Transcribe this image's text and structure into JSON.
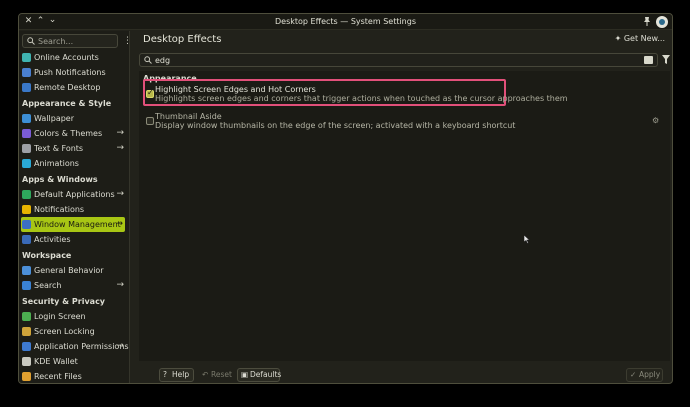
{
  "window": {
    "title": "Desktop Effects — System Settings"
  },
  "sidebar": {
    "search_placeholder": "Search...",
    "items_top": [
      {
        "label": "Online Accounts",
        "icon": "online-accounts-icon",
        "color": "#3fb3b0"
      },
      {
        "label": "Push Notifications",
        "icon": "push-notifications-icon",
        "color": "#4a7fd0"
      },
      {
        "label": "Remote Desktop",
        "icon": "remote-desktop-icon",
        "color": "#3a78c8"
      }
    ],
    "sections": [
      {
        "title": "Appearance & Style",
        "items": [
          {
            "label": "Wallpaper",
            "icon": "wallpaper-icon",
            "color": "#3d8fd6",
            "arrow": false
          },
          {
            "label": "Colors & Themes",
            "icon": "colors-themes-icon",
            "color": "#7b5bd6",
            "arrow": true
          },
          {
            "label": "Text & Fonts",
            "icon": "text-fonts-icon",
            "color": "#9ea0a6",
            "arrow": true
          },
          {
            "label": "Animations",
            "icon": "animations-icon",
            "color": "#2aa9d6",
            "arrow": false
          }
        ]
      },
      {
        "title": "Apps & Windows",
        "items": [
          {
            "label": "Default Applications",
            "icon": "default-applications-icon",
            "color": "#2ea85c",
            "arrow": true
          },
          {
            "label": "Notifications",
            "icon": "notifications-icon",
            "color": "#e8b400",
            "arrow": false
          },
          {
            "label": "Window Management",
            "icon": "window-management-icon",
            "color": "#3b6fc4",
            "arrow": true,
            "active": true
          },
          {
            "label": "Activities",
            "icon": "activities-icon",
            "color": "#3a6ab8",
            "arrow": false
          }
        ]
      },
      {
        "title": "Workspace",
        "items": [
          {
            "label": "General Behavior",
            "icon": "general-behavior-icon",
            "color": "#4c8fd8",
            "arrow": false
          },
          {
            "label": "Search",
            "icon": "search-icon",
            "color": "#3a82d4",
            "arrow": true
          }
        ]
      },
      {
        "title": "Security & Privacy",
        "items": [
          {
            "label": "Login Screen",
            "icon": "login-screen-icon",
            "color": "#4caf50",
            "arrow": false
          },
          {
            "label": "Screen Locking",
            "icon": "screen-locking-icon",
            "color": "#d0a43a",
            "arrow": false
          },
          {
            "label": "Application Permissions",
            "icon": "application-permissions-icon",
            "color": "#3e7ad0",
            "arrow": true
          },
          {
            "label": "KDE Wallet",
            "icon": "kde-wallet-icon",
            "color": "#c9c9c0",
            "arrow": false
          },
          {
            "label": "Recent Files",
            "icon": "recent-files-icon",
            "color": "#e0a030",
            "arrow": false
          }
        ]
      }
    ]
  },
  "main": {
    "title": "Desktop Effects",
    "get_new_label": "Get New...",
    "filter_value": "edg",
    "group_title": "Appearance",
    "effects": [
      {
        "name": "Highlight Screen Edges and Hot Corners",
        "description": "Highlights screen edges and corners that trigger actions when touched as the cursor approaches them",
        "checked": true
      },
      {
        "name": "Thumbnail Aside",
        "description": "Display window thumbnails on the edge of the screen; activated with a keyboard shortcut",
        "checked": false
      }
    ],
    "highlight_color": "#e2507a",
    "accent_color": "#a8c614"
  },
  "footer": {
    "help_label": "Help",
    "reset_label": "Reset",
    "defaults_label": "Defaults",
    "apply_label": "Apply"
  }
}
